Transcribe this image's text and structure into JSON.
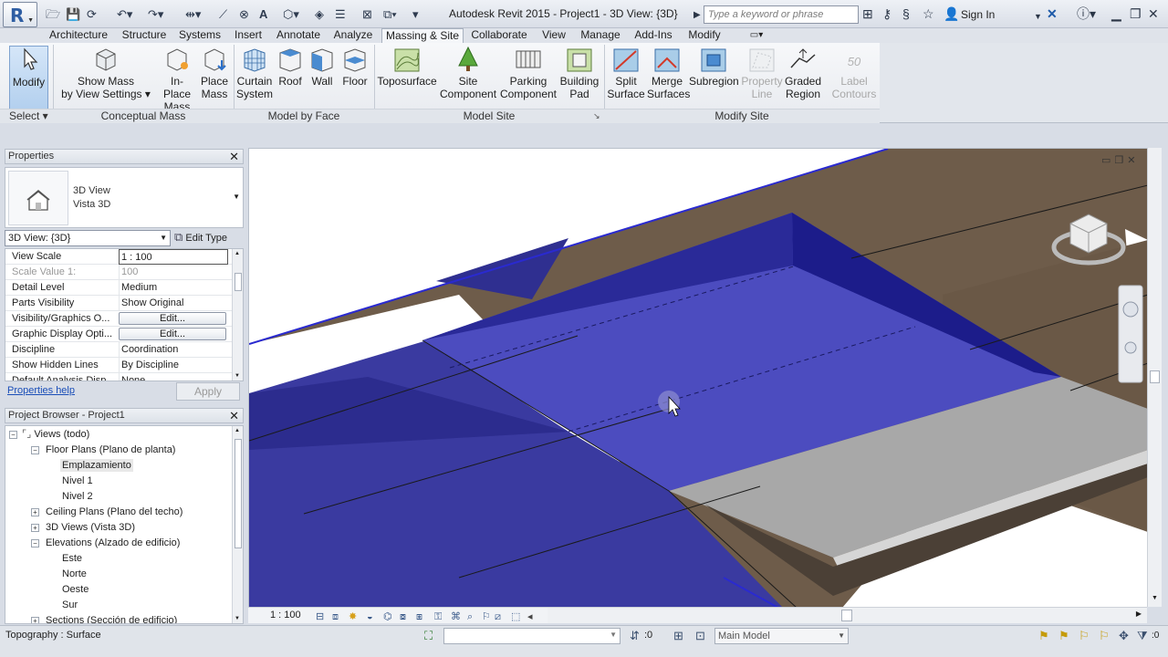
{
  "title_bar": {
    "app_title": "Autodesk Revit 2015 -    Project1 - 3D View: {3D}",
    "search_placeholder": "Type a keyword or phrase",
    "sign_in": "Sign In",
    "app_letter": "R"
  },
  "tabs": [
    "Architecture",
    "Structure",
    "Systems",
    "Insert",
    "Annotate",
    "Analyze",
    "Massing & Site",
    "Collaborate",
    "View",
    "Manage",
    "Add-Ins",
    "Modify"
  ],
  "active_tab": "Massing & Site",
  "ribbon": {
    "select": {
      "modify_label": "Modify",
      "panel_title": "Select ▾"
    },
    "conceptual_mass": {
      "panel_title": "Conceptual Mass",
      "show_mass": "Show Mass",
      "show_mass_2": "by View Settings ▾",
      "in_place_mass": "In-Place",
      "in_place_mass_2": "Mass",
      "place_mass": "Place",
      "place_mass_2": "Mass"
    },
    "model_by_face": {
      "panel_title": "Model by Face",
      "curtain_system": "Curtain",
      "curtain_system_2": "System",
      "roof": "Roof",
      "wall": "Wall",
      "floor": "Floor"
    },
    "model_site": {
      "panel_title": "Model Site",
      "toposurface": "Toposurface",
      "site_component": "Site",
      "site_component_2": "Component",
      "parking_component": "Parking",
      "parking_component_2": "Component",
      "building_pad": "Building",
      "building_pad_2": "Pad"
    },
    "modify_site": {
      "panel_title": "Modify Site",
      "split_surface": "Split",
      "split_surface_2": "Surface",
      "merge_surfaces": "Merge",
      "merge_surfaces_2": "Surfaces",
      "subregion": "Subregion",
      "property_line": "Property",
      "property_line_2": "Line",
      "graded_region": "Graded",
      "graded_region_2": "Region",
      "label_contours": "Label",
      "label_contours_2": "Contours",
      "label_contours_num": "50"
    }
  },
  "properties": {
    "header": "Properties",
    "type_line1": "3D View",
    "type_line2": "Vista 3D",
    "view_select": "3D View: {3D}",
    "edit_type": "Edit Type",
    "rows": [
      {
        "name": "View Scale",
        "value": "1 : 100"
      },
      {
        "name": "Scale Value    1:",
        "value": "100"
      },
      {
        "name": "Detail Level",
        "value": "Medium"
      },
      {
        "name": "Parts Visibility",
        "value": "Show Original"
      },
      {
        "name": "Visibility/Graphics O...",
        "value": "Edit..."
      },
      {
        "name": "Graphic Display Opti...",
        "value": "Edit..."
      },
      {
        "name": "Discipline",
        "value": "Coordination"
      },
      {
        "name": "Show Hidden Lines",
        "value": "By Discipline"
      },
      {
        "name": "Default Analysis Disp...",
        "value": "None"
      }
    ],
    "help_link": "Properties help",
    "apply": "Apply"
  },
  "project_browser": {
    "header": "Project Browser - Project1",
    "nodes": [
      "Views (todo)",
      "Floor Plans (Plano de planta)",
      "Emplazamiento",
      "Nivel 1",
      "Nivel 2",
      "Ceiling Plans (Plano del techo)",
      "3D Views (Vista 3D)",
      "Elevations (Alzado de edificio)",
      "Este",
      "Norte",
      "Oeste",
      "Sur",
      "Sections (Sección de edificio)"
    ]
  },
  "view_control": {
    "scale": "1 : 100"
  },
  "status_bar": {
    "text": "Topography : Surface",
    "filter_count": ":0",
    "model": "Main Model"
  },
  "colors": {
    "topography": "#6e5c4a",
    "pad_blue": "#3c3ca8",
    "pad_dark": "#1e1e88",
    "slab_gray": "#a9a9a9",
    "ribbon_active": "#f4f6f9"
  }
}
